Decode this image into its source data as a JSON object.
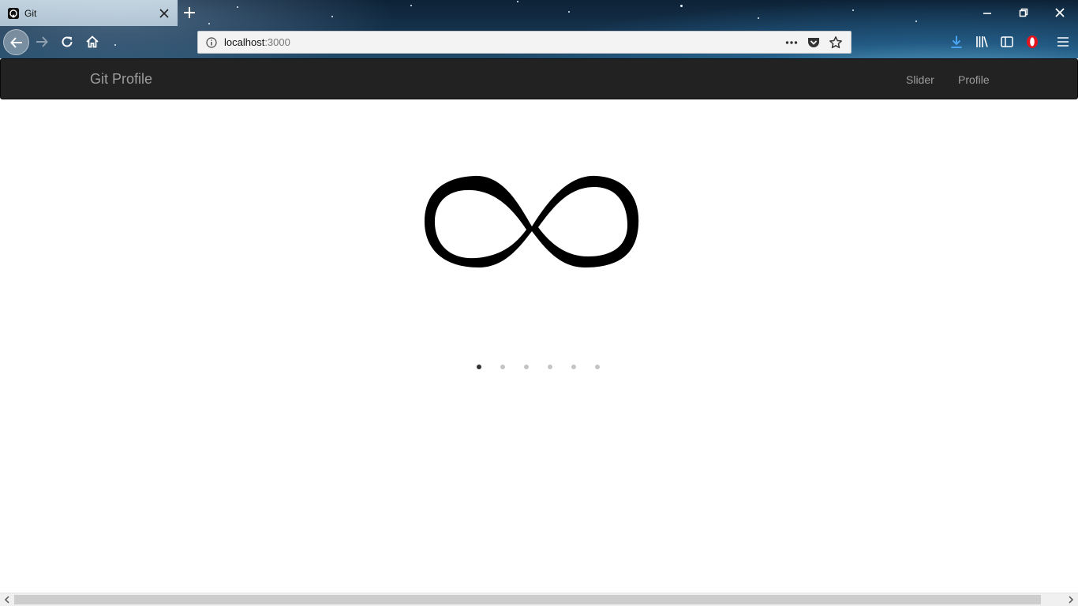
{
  "browser": {
    "tab": {
      "title": "Git",
      "favicon": "github-icon",
      "close_icon": "close-icon"
    },
    "new_tab_icon": "plus-icon",
    "window_controls": [
      "minimize-icon",
      "restore-icon",
      "close-icon"
    ],
    "nav": {
      "back_icon": "arrow-left-icon",
      "forward_icon": "arrow-right-icon",
      "reload_icon": "reload-icon",
      "home_icon": "home-icon"
    },
    "url": {
      "host": "localhost",
      "port": ":3000",
      "info_icon": "info-icon"
    },
    "url_actions": [
      "more-icon",
      "pocket-icon",
      "bookmark-star-icon"
    ],
    "toolbar": [
      "download-icon",
      "library-icon",
      "sidebar-icon",
      "opera-icon",
      "menu-icon"
    ],
    "colors": {
      "download_accent": "#4aa3f0",
      "opera_red": "#e3141f"
    }
  },
  "navbar": {
    "brand": "Git Profile",
    "links": [
      "Slider",
      "Profile"
    ],
    "background": "#222222",
    "text_color": "#9d9d9d"
  },
  "carousel": {
    "slide_image": "infinity-symbol",
    "slide_count": 6,
    "active_index": 0,
    "indicator_active_color": "#333333",
    "indicator_inactive_color": "#c4c4c4"
  },
  "scrollbar": {
    "left_icon": "chevron-left-icon",
    "right_icon": "chevron-right-icon"
  }
}
